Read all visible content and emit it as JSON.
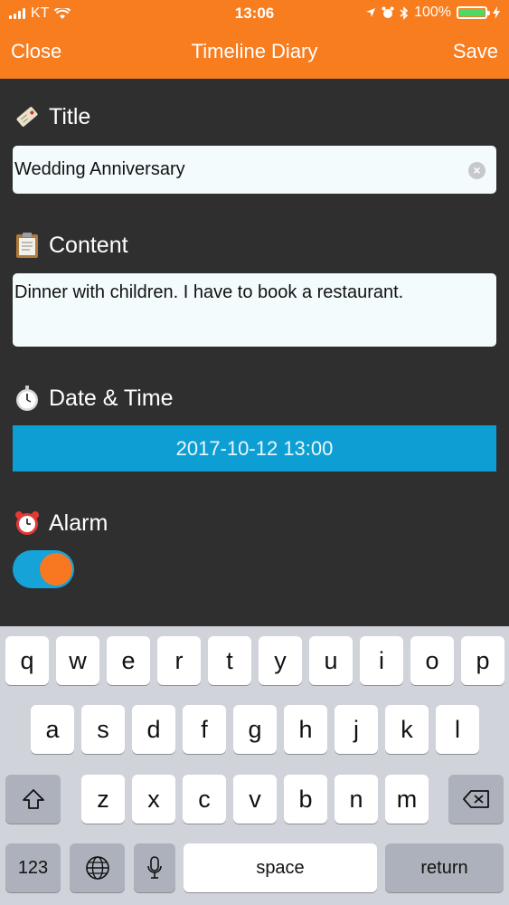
{
  "status_bar": {
    "carrier": "KT",
    "time": "13:06",
    "battery": "100%"
  },
  "nav": {
    "close_label": "Close",
    "title": "Timeline Diary",
    "save_label": "Save"
  },
  "form": {
    "title_label": "Title",
    "title_value": "Wedding Anniversary",
    "content_label": "Content",
    "content_value": "Dinner with children. I have to book a restaurant.",
    "datetime_label": "Date & Time",
    "datetime_value": "2017-10-12 13:00",
    "alarm_label": "Alarm",
    "alarm_on": true
  },
  "keyboard": {
    "row1": [
      "q",
      "w",
      "e",
      "r",
      "t",
      "y",
      "u",
      "i",
      "o",
      "p"
    ],
    "row2": [
      "a",
      "s",
      "d",
      "f",
      "g",
      "h",
      "j",
      "k",
      "l"
    ],
    "row3": [
      "z",
      "x",
      "c",
      "v",
      "b",
      "n",
      "m"
    ],
    "numbers_label": "123",
    "space_label": "space",
    "return_label": "return"
  },
  "colors": {
    "accent": "#f77d1f",
    "background": "#2f2f2f",
    "date_button": "#0d9fd4",
    "toggle_track": "#16a3d8",
    "toggle_knob": "#f87821"
  },
  "icons": {
    "title": "tag-icon",
    "content": "clipboard-icon",
    "datetime": "stopwatch-icon",
    "alarm": "alarm-clock-icon"
  }
}
